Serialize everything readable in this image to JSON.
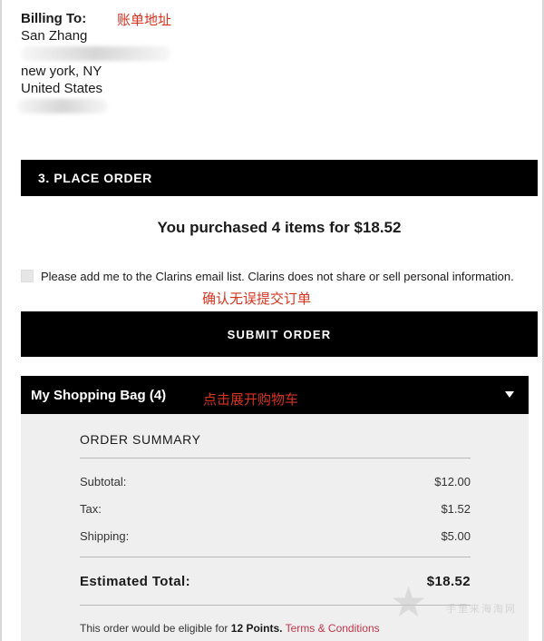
{
  "billing": {
    "label": "Billing To:",
    "name": "San Zhang",
    "city_line": "new york, NY",
    "country": "United States"
  },
  "annotations": {
    "billing_address": "账单地址",
    "confirm_submit": "确认无误提交订单",
    "expand_cart": "点击展开购物车"
  },
  "step": {
    "label": "3. PLACE ORDER"
  },
  "purchase_summary": "You purchased 4 items for $18.52",
  "optin": {
    "checked": false,
    "text": "Please add me to the Clarins email list. Clarins does not share or sell personal information."
  },
  "submit_button": "SUBMIT ORDER",
  "bag": {
    "title": "My Shopping Bag (4)",
    "expand_icon": "caret-down-icon"
  },
  "order_summary": {
    "title": "ORDER SUMMARY",
    "rows": [
      {
        "label": "Subtotal:",
        "value": "$12.00"
      },
      {
        "label": "Tax:",
        "value": "$1.52"
      },
      {
        "label": "Shipping:",
        "value": "$5.00"
      }
    ],
    "total": {
      "label": "Estimated Total:",
      "value": "$18.52"
    },
    "eligible_prefix": "This order would be eligible for",
    "points": "12 Points.",
    "terms_link": "Terms & Conditions"
  },
  "watermark": "手里来海淘网",
  "colors": {
    "bar_bg": "#000000",
    "panel_bg": "#efefef",
    "annotation": "#d6331f",
    "link": "#c2364a"
  }
}
